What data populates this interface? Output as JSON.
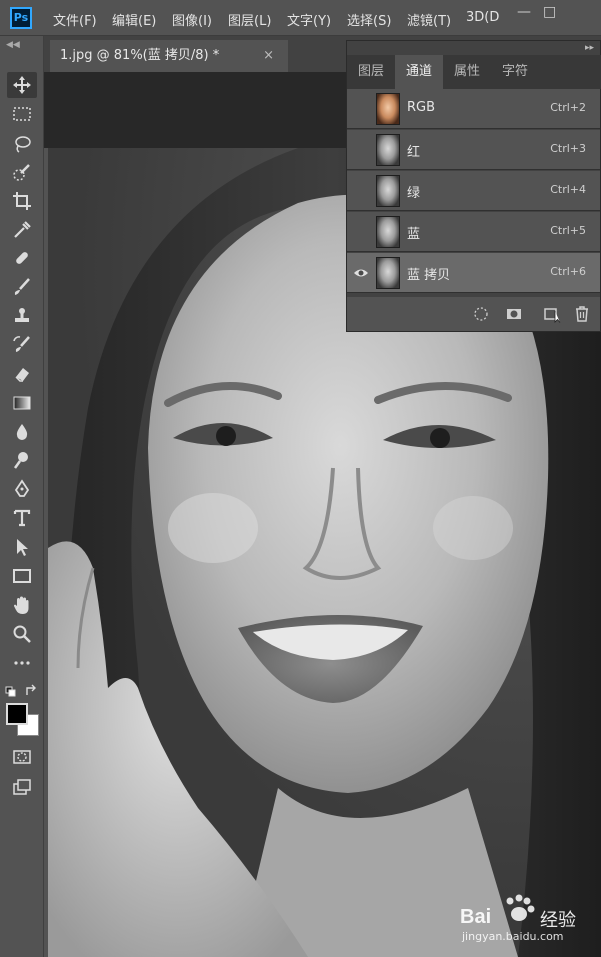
{
  "app": {
    "logo": "Ps"
  },
  "menu": [
    "文件(F)",
    "编辑(E)",
    "图像(I)",
    "图层(L)",
    "文字(Y)",
    "选择(S)",
    "滤镜(T)",
    "3D(D"
  ],
  "window_buttons": [
    "—",
    "□"
  ],
  "toolbar_tools": [
    "move-tool-icon",
    "marquee-tool-icon",
    "lasso-tool-icon",
    "quick-select-tool-icon",
    "crop-tool-icon",
    "eyedropper-tool-icon",
    "healing-brush-tool-icon",
    "brush-tool-icon",
    "stamp-tool-icon",
    "history-brush-tool-icon",
    "eraser-tool-icon",
    "gradient-tool-icon",
    "blur-tool-icon",
    "dodge-tool-icon",
    "pen-tool-icon",
    "type-tool-icon",
    "path-select-tool-icon",
    "rectangle-tool-icon",
    "hand-tool-icon",
    "zoom-tool-icon",
    "more-tools-icon"
  ],
  "colors": {
    "foreground": "#000000",
    "background": "#ffffff",
    "accent": "#31a8ff"
  },
  "document": {
    "tab_title": "1.jpg @ 81%(蓝 拷贝/8) *",
    "close": "×"
  },
  "panel": {
    "tabs": [
      "图层",
      "通道",
      "属性",
      "字符"
    ],
    "active_tab": "通道",
    "channels": [
      {
        "name": "RGB",
        "shortcut": "Ctrl+2",
        "visible": false,
        "selected": false
      },
      {
        "name": "红",
        "shortcut": "Ctrl+3",
        "visible": false,
        "selected": false
      },
      {
        "name": "绿",
        "shortcut": "Ctrl+4",
        "visible": false,
        "selected": false
      },
      {
        "name": "蓝",
        "shortcut": "Ctrl+5",
        "visible": false,
        "selected": false
      },
      {
        "name": "蓝 拷贝",
        "shortcut": "Ctrl+6",
        "visible": true,
        "selected": true
      }
    ],
    "footer_icons": [
      "load-selection-icon",
      "save-selection-icon",
      "new-channel-icon",
      "delete-channel-icon"
    ]
  },
  "watermark": {
    "brand": "Bai",
    "brand_suffix": "经验",
    "url": "jingyan.baidu.com"
  }
}
